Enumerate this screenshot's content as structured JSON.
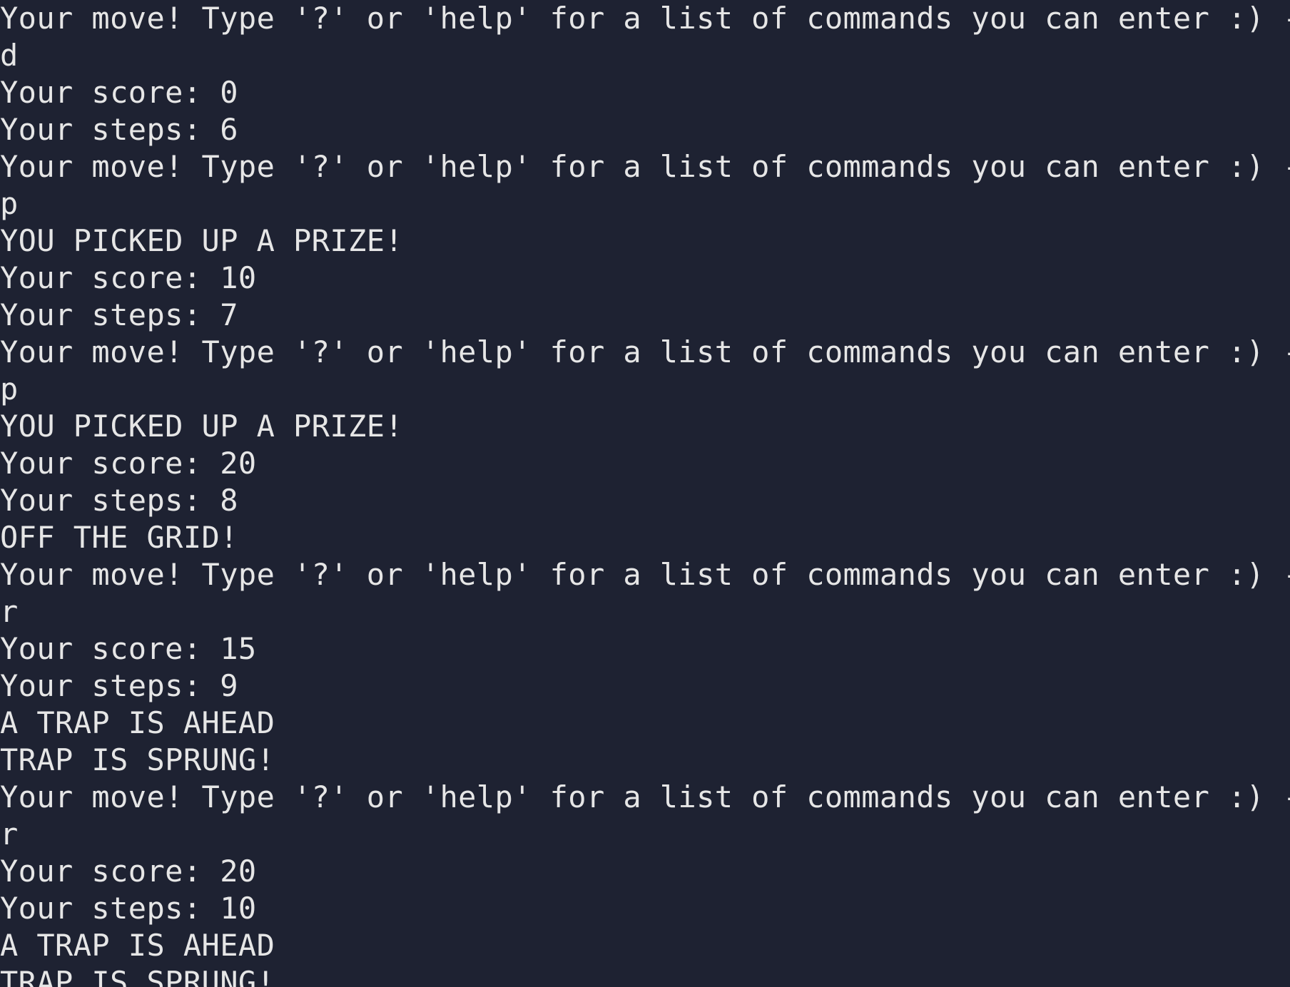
{
  "terminal": {
    "background": "#1e2232",
    "foreground": "#e6e6e6",
    "lines": [
      "Your move! Type '?' or 'help' for a list of commands you can enter :) -->",
      "d",
      "Your score: 0",
      "Your steps: 6",
      "Your move! Type '?' or 'help' for a list of commands you can enter :) -->",
      "p",
      "YOU PICKED UP A PRIZE!",
      "Your score: 10",
      "Your steps: 7",
      "Your move! Type '?' or 'help' for a list of commands you can enter :) -->",
      "p",
      "YOU PICKED UP A PRIZE!",
      "Your score: 20",
      "Your steps: 8",
      "OFF THE GRID!",
      "Your move! Type '?' or 'help' for a list of commands you can enter :) -->",
      "r",
      "Your score: 15",
      "Your steps: 9",
      "A TRAP IS AHEAD",
      "TRAP IS SPRUNG!",
      "Your move! Type '?' or 'help' for a list of commands you can enter :) -->",
      "r",
      "Your score: 20",
      "Your steps: 10",
      "A TRAP IS AHEAD",
      "TRAP IS SPRUNG!"
    ]
  }
}
